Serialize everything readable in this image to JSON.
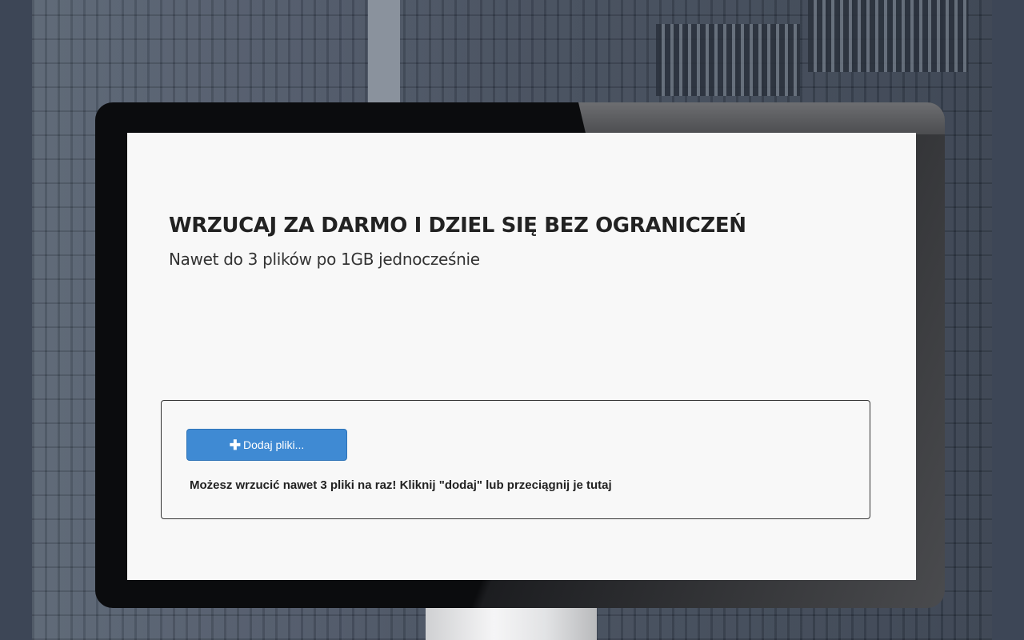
{
  "hero": {
    "title": "WRZUCAJ ZA DARMO I DZIEL SIĘ BEZ OGRANICZEŃ",
    "subtitle": "Nawet do 3 plików po 1GB jednocześnie"
  },
  "upload": {
    "add_button_label": "Dodaj pliki...",
    "add_button_icon": "plus-icon",
    "hint": "Możesz wrzucić nawet 3 pliki na raz! Kliknij \"dodaj\" lub przeciągnij je tutaj",
    "accent_color": "#3f8ad3"
  }
}
